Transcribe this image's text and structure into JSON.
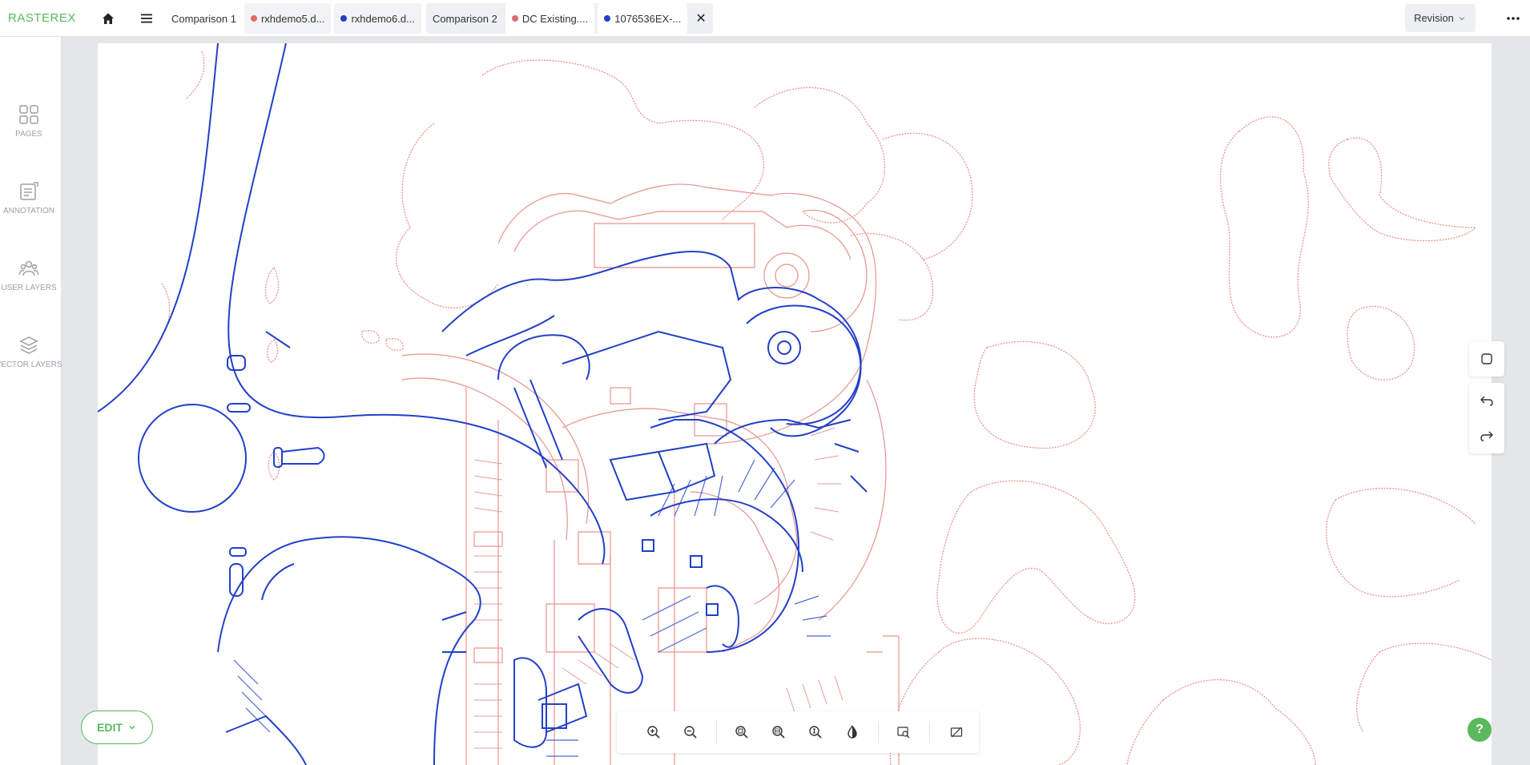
{
  "app": {
    "logo": "RASTEREX"
  },
  "topbar": {
    "home_icon": "home-icon",
    "menu_icon": "hamburger-menu-icon",
    "revision_label": "Revision",
    "more_icon": "more-horizontal-icon"
  },
  "tabs": {
    "group1": {
      "label": "Comparison 1",
      "file_a": {
        "label": "rxhdemo5.d...",
        "color": "#e06b6b"
      },
      "file_b": {
        "label": "rxhdemo6.d...",
        "color": "#2340c8"
      }
    },
    "group2": {
      "label": "Comparison 2",
      "file_a": {
        "label": "DC Existing....",
        "color": "#e06b6b"
      },
      "file_b": {
        "label": "1076536EX-...",
        "color": "#2340c8"
      },
      "close": "✕"
    }
  },
  "sidebar": {
    "items": [
      {
        "label": "PAGES",
        "icon": "pages-grid-icon"
      },
      {
        "label": "ANNOTATION",
        "icon": "annotation-icon"
      },
      {
        "label": "USER LAYERS",
        "icon": "user-layers-icon"
      },
      {
        "label": "VECTOR LAYERS",
        "icon": "vector-layers-icon"
      }
    ]
  },
  "edit_button": {
    "label": "EDIT"
  },
  "colors": {
    "accent": "#5bb85c",
    "overlay_red": "#e8928c",
    "overlay_blue": "#2340c8"
  },
  "toolbar_icons": [
    "zoom-in-icon",
    "zoom-out-icon",
    "zoom-window-icon",
    "zoom-out-area-icon",
    "zoom-extents-icon",
    "contrast-icon",
    "search-area-icon",
    "hide-overlay-icon"
  ],
  "right_tools": [
    "select-shape-icon",
    "undo-icon",
    "redo-icon"
  ],
  "help": {
    "label": "?"
  }
}
